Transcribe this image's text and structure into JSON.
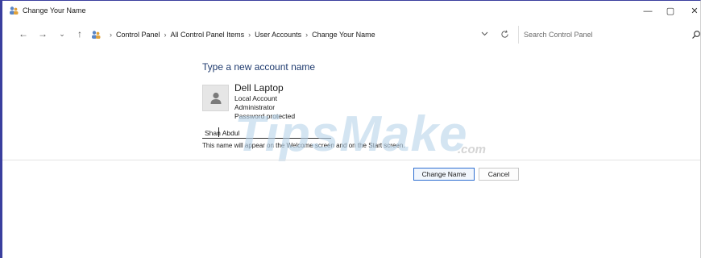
{
  "window": {
    "title": "Change Your Name"
  },
  "titlebar_buttons": {
    "minimize": "—",
    "maximize": "▢",
    "close": "✕"
  },
  "nav": {
    "back": "←",
    "forward": "→",
    "recent": "⌄",
    "up": "↑"
  },
  "breadcrumb": [
    "Control Panel",
    "All Control Panel Items",
    "User Accounts",
    "Change Your Name"
  ],
  "breadcrumb_separator": "›",
  "search": {
    "placeholder": "Search Control Panel"
  },
  "content": {
    "heading": "Type a new account name",
    "account": {
      "name": "Dell Laptop",
      "details": [
        "Local Account",
        "Administrator",
        "Password protected"
      ]
    },
    "name_input_value": "Shan Abdul",
    "hint": "This name will appear on the Welcome screen and on the Start screen."
  },
  "watermark": {
    "main": "TipsMake",
    "suffix": ".com"
  },
  "buttons": {
    "change_name": "Change Name",
    "cancel": "Cancel"
  },
  "colors": {
    "heading": "#1e3a6e",
    "primary_border": "#2f6fd1",
    "window_accent": "#3a3f9e"
  },
  "icons": {
    "title": "user-accounts-icon",
    "breadcrumb": "user-accounts-icon",
    "search": "search-icon",
    "refresh": "refresh-icon",
    "avatar": "user-avatar-icon"
  }
}
